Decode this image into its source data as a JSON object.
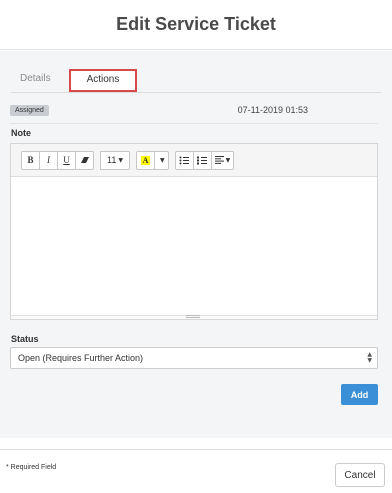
{
  "modal": {
    "title": "Edit Service Ticket"
  },
  "tabs": [
    {
      "label": "Details",
      "active": false
    },
    {
      "label": "Actions",
      "active": true
    }
  ],
  "ticket": {
    "status_badge": "Assigned",
    "timestamp": "07-11-2019 01:53"
  },
  "note": {
    "label": "Note",
    "toolbar": {
      "bold": "B",
      "italic": "I",
      "underline": "U",
      "eraser": "eraser-icon",
      "font_size": "11",
      "highlight": "A",
      "unordered_list": "bullet-list-icon",
      "ordered_list": "numbered-list-icon",
      "align": "align-left-icon"
    },
    "value": ""
  },
  "status": {
    "label": "Status",
    "selected": "Open (Requires Further Action)"
  },
  "buttons": {
    "add": "Add",
    "cancel": "Cancel"
  },
  "footer": {
    "required_note": "* Required Field"
  },
  "colors": {
    "accent": "#3a8fd6",
    "tab_highlight": "#d64a4a",
    "highlight_yellow": "#ffff00"
  }
}
